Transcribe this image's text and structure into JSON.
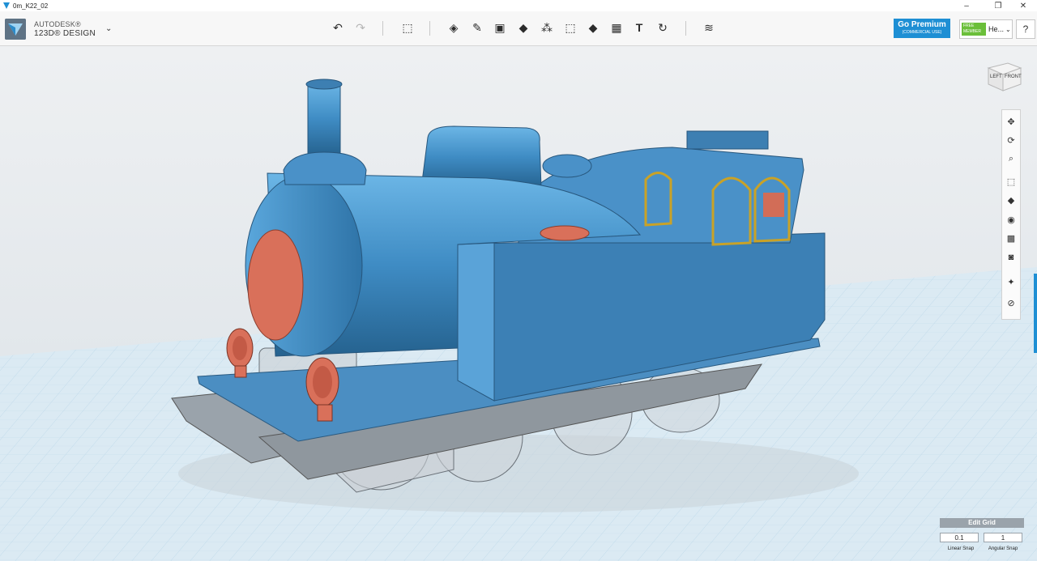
{
  "window": {
    "title": "0m_K22_02",
    "controls": [
      "minimize-icon",
      "restore-icon",
      "close-icon"
    ]
  },
  "brand": {
    "line1": "AUTODESK®",
    "line2": "123D® DESIGN",
    "menu_icon": "chevron-down-icon"
  },
  "toolbar": {
    "undo_icon": "undo-icon",
    "redo_icon": "redo-icon",
    "tools": [
      "transform-icon",
      "primitives-icon",
      "sketch-icon",
      "construct-icon",
      "modify-icon",
      "pattern-icon",
      "group-icon",
      "combine-icon",
      "measure-icon",
      "text-icon",
      "snap-icon",
      "material-icon"
    ]
  },
  "account": {
    "premium_label": "Go Premium",
    "premium_sub": "(COMMERCIAL USE)",
    "badge_line1": "FREE",
    "badge_line2": "MEMBER",
    "user": "He...",
    "help": "?"
  },
  "viewcube": {
    "left": "LEFT",
    "front": "FRONT"
  },
  "nav_tools": [
    "pan-icon",
    "orbit-icon",
    "zoom-icon",
    "fit-icon",
    "view-mode-icon",
    "visibility-icon",
    "materials-outline-icon",
    "camera-icon",
    "snap-toggle-icon",
    "grid-toggle-icon"
  ],
  "grid_panel": {
    "title": "Edit Grid",
    "linear_value": "0.1",
    "angular_value": "1",
    "linear_label": "Linear Snap",
    "angular_label": "Angular Snap"
  },
  "colors": {
    "accent": "#1e8fd4",
    "model_body": "#4a90c6",
    "model_parts": "#d9705a",
    "window_frame": "#c9a227"
  }
}
